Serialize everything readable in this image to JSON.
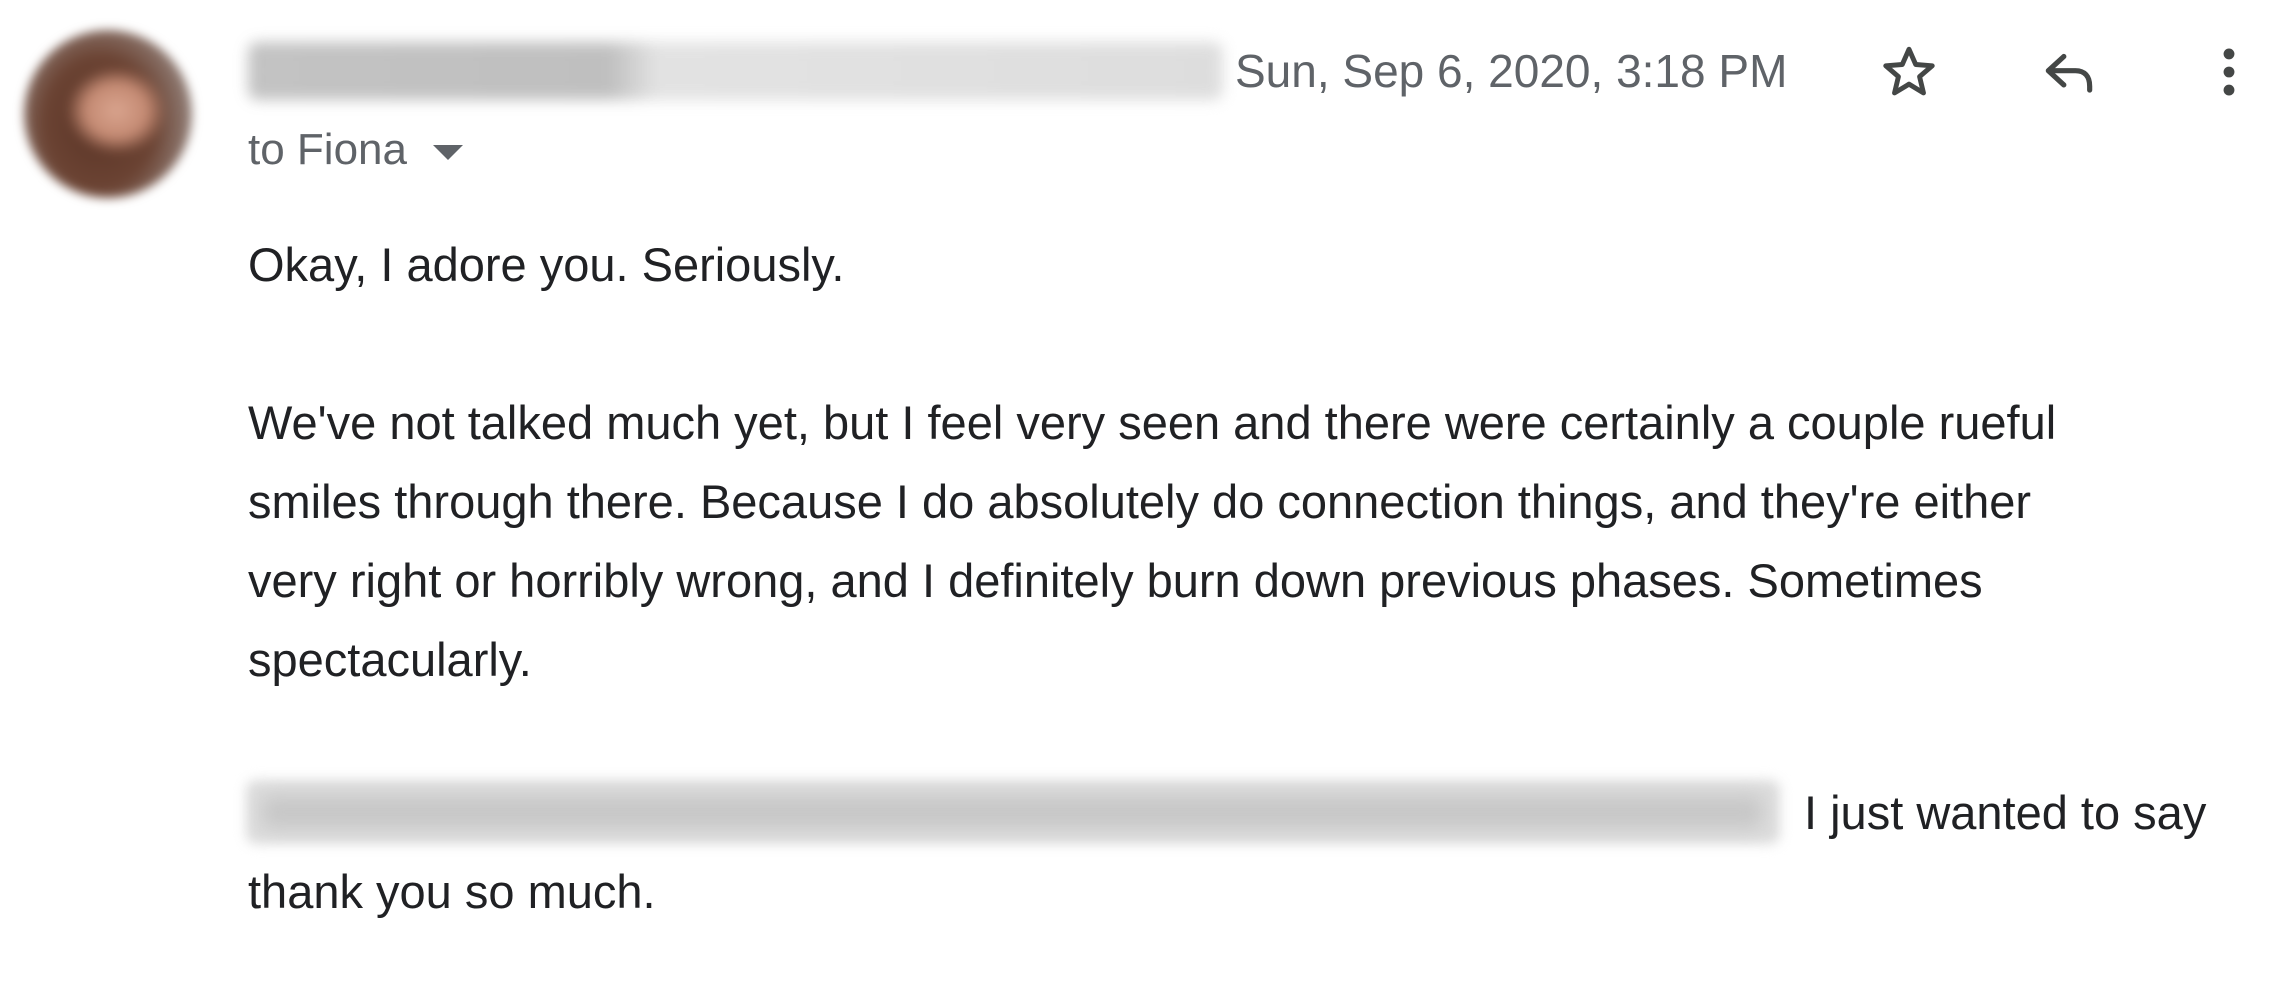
{
  "header": {
    "timestamp": "Sun, Sep 6, 2020, 3:18 PM",
    "recipient": "to Fiona"
  },
  "icons": {
    "star": "star-icon",
    "reply": "reply-icon",
    "more": "more-vert-icon",
    "recipient_toggle": "caret-down-icon"
  },
  "body": {
    "greeting": "Okay, I adore you. Seriously.",
    "p1_line1": "We've not talked much yet, but I feel very seen and there were certainly a couple rueful",
    "p1_line2": "smiles through there. Because I do absolutely do connection things, and they're either",
    "p1_line3": "very right or horribly wrong, and I definitely burn down previous phases. Sometimes",
    "p1_line4": "spectacularly.",
    "p2_line1_visible": "I just wanted to say",
    "p2_line2": "thank you so much."
  },
  "colors": {
    "text": "#202124",
    "secondary": "#5f6368",
    "background": "#ffffff"
  }
}
